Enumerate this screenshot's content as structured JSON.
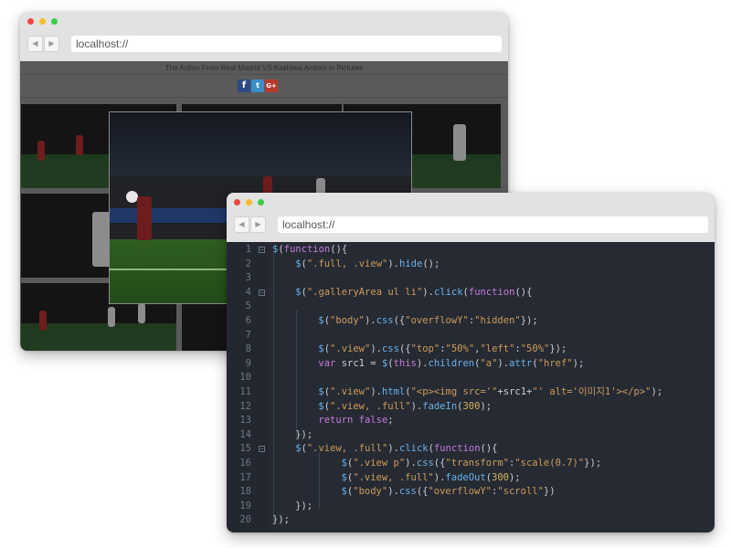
{
  "back_window": {
    "url": "localhost://",
    "caption": "The Action From Real Madrid VS Kashima Antlers in Pictures",
    "share": {
      "facebook": "f",
      "twitter": "t",
      "googleplus": "G+"
    }
  },
  "front_window": {
    "url": "localhost://"
  },
  "code_lines": [
    {
      "n": "1",
      "fold": "−",
      "indent": 0,
      "tokens": [
        [
          "t-fn",
          "$"
        ],
        [
          "t-p",
          "("
        ],
        [
          "t-kw",
          "function"
        ],
        [
          "t-p",
          "(){"
        ]
      ]
    },
    {
      "n": "2",
      "fold": "",
      "indent": 1,
      "tokens": [
        [
          "t-fn",
          "$"
        ],
        [
          "t-p",
          "("
        ],
        [
          "t-str",
          "\".full, .view\""
        ],
        [
          "t-p",
          ")."
        ],
        [
          "t-fn",
          "hide"
        ],
        [
          "t-p",
          "();"
        ]
      ]
    },
    {
      "n": "3",
      "fold": "",
      "indent": 0,
      "tokens": []
    },
    {
      "n": "4",
      "fold": "−",
      "indent": 1,
      "tokens": [
        [
          "t-fn",
          "$"
        ],
        [
          "t-p",
          "("
        ],
        [
          "t-str",
          "\".galleryArea ul li\""
        ],
        [
          "t-p",
          ")."
        ],
        [
          "t-fn",
          "click"
        ],
        [
          "t-p",
          "("
        ],
        [
          "t-kw",
          "function"
        ],
        [
          "t-p",
          "(){"
        ]
      ]
    },
    {
      "n": "5",
      "fold": "",
      "indent": 0,
      "tokens": []
    },
    {
      "n": "6",
      "fold": "",
      "indent": 2,
      "tokens": [
        [
          "t-fn",
          "$"
        ],
        [
          "t-p",
          "("
        ],
        [
          "t-str",
          "\"body\""
        ],
        [
          "t-p",
          ")."
        ],
        [
          "t-fn",
          "css"
        ],
        [
          "t-p",
          "({"
        ],
        [
          "t-str",
          "\"overflowY\""
        ],
        [
          "t-p",
          ":"
        ],
        [
          "t-str",
          "\"hidden\""
        ],
        [
          "t-p",
          "});"
        ]
      ]
    },
    {
      "n": "7",
      "fold": "",
      "indent": 0,
      "tokens": []
    },
    {
      "n": "8",
      "fold": "",
      "indent": 2,
      "tokens": [
        [
          "t-fn",
          "$"
        ],
        [
          "t-p",
          "("
        ],
        [
          "t-str",
          "\".view\""
        ],
        [
          "t-p",
          ")."
        ],
        [
          "t-fn",
          "css"
        ],
        [
          "t-p",
          "({"
        ],
        [
          "t-str",
          "\"top\""
        ],
        [
          "t-p",
          ":"
        ],
        [
          "t-str",
          "\"50%\""
        ],
        [
          "t-p",
          ","
        ],
        [
          "t-str",
          "\"left\""
        ],
        [
          "t-p",
          ":"
        ],
        [
          "t-str",
          "\"50%\""
        ],
        [
          "t-p",
          "});"
        ]
      ]
    },
    {
      "n": "9",
      "fold": "",
      "indent": 2,
      "tokens": [
        [
          "t-kw",
          "var"
        ],
        [
          "t-p",
          " src1 = "
        ],
        [
          "t-fn",
          "$"
        ],
        [
          "t-p",
          "("
        ],
        [
          "t-kw",
          "this"
        ],
        [
          "t-p",
          ")."
        ],
        [
          "t-fn",
          "children"
        ],
        [
          "t-p",
          "("
        ],
        [
          "t-str",
          "\"a\""
        ],
        [
          "t-p",
          ")."
        ],
        [
          "t-fn",
          "attr"
        ],
        [
          "t-p",
          "("
        ],
        [
          "t-str",
          "\"href\""
        ],
        [
          "t-p",
          ");"
        ]
      ]
    },
    {
      "n": "10",
      "fold": "",
      "indent": 0,
      "tokens": []
    },
    {
      "n": "11",
      "fold": "",
      "indent": 2,
      "tokens": [
        [
          "t-fn",
          "$"
        ],
        [
          "t-p",
          "("
        ],
        [
          "t-str",
          "\".view\""
        ],
        [
          "t-p",
          ")."
        ],
        [
          "t-fn",
          "html"
        ],
        [
          "t-p",
          "("
        ],
        [
          "t-str",
          "\"<p><img src='\""
        ],
        [
          "t-p",
          "+src1+"
        ],
        [
          "t-str",
          "\"' alt='이미지1'></p>\""
        ],
        [
          "t-p",
          ");"
        ]
      ]
    },
    {
      "n": "12",
      "fold": "",
      "indent": 2,
      "tokens": [
        [
          "t-fn",
          "$"
        ],
        [
          "t-p",
          "("
        ],
        [
          "t-str",
          "\".view, .full\""
        ],
        [
          "t-p",
          ")."
        ],
        [
          "t-fn",
          "fadeIn"
        ],
        [
          "t-p",
          "("
        ],
        [
          "t-num",
          "300"
        ],
        [
          "t-p",
          ");"
        ]
      ]
    },
    {
      "n": "13",
      "fold": "",
      "indent": 2,
      "tokens": [
        [
          "t-kw",
          "return"
        ],
        [
          "t-p",
          " "
        ],
        [
          "t-kw",
          "false"
        ],
        [
          "t-p",
          ";"
        ]
      ]
    },
    {
      "n": "14",
      "fold": "",
      "indent": 1,
      "tokens": [
        [
          "t-p",
          "});"
        ]
      ]
    },
    {
      "n": "15",
      "fold": "−",
      "indent": 1,
      "tokens": [
        [
          "t-fn",
          "$"
        ],
        [
          "t-p",
          "("
        ],
        [
          "t-str",
          "\".view, .full\""
        ],
        [
          "t-p",
          ")."
        ],
        [
          "t-fn",
          "click"
        ],
        [
          "t-p",
          "("
        ],
        [
          "t-kw",
          "function"
        ],
        [
          "t-p",
          "(){"
        ]
      ]
    },
    {
      "n": "16",
      "fold": "",
      "indent": 3,
      "tokens": [
        [
          "t-fn",
          "$"
        ],
        [
          "t-p",
          "("
        ],
        [
          "t-str",
          "\".view p\""
        ],
        [
          "t-p",
          ")."
        ],
        [
          "t-fn",
          "css"
        ],
        [
          "t-p",
          "({"
        ],
        [
          "t-str",
          "\"transform\""
        ],
        [
          "t-p",
          ":"
        ],
        [
          "t-str",
          "\"scale(0.7)\""
        ],
        [
          "t-p",
          "});"
        ]
      ]
    },
    {
      "n": "17",
      "fold": "",
      "indent": 3,
      "tokens": [
        [
          "t-fn",
          "$"
        ],
        [
          "t-p",
          "("
        ],
        [
          "t-str",
          "\".view, .full\""
        ],
        [
          "t-p",
          ")."
        ],
        [
          "t-fn",
          "fadeOut"
        ],
        [
          "t-p",
          "("
        ],
        [
          "t-num",
          "300"
        ],
        [
          "t-p",
          ");"
        ]
      ]
    },
    {
      "n": "18",
      "fold": "",
      "indent": 3,
      "tokens": [
        [
          "t-fn",
          "$"
        ],
        [
          "t-p",
          "("
        ],
        [
          "t-str",
          "\"body\""
        ],
        [
          "t-p",
          ")."
        ],
        [
          "t-fn",
          "css"
        ],
        [
          "t-p",
          "({"
        ],
        [
          "t-str",
          "\"overflowY\""
        ],
        [
          "t-p",
          ":"
        ],
        [
          "t-str",
          "\"scroll\""
        ],
        [
          "t-p",
          "})"
        ]
      ]
    },
    {
      "n": "19",
      "fold": "",
      "indent": 1,
      "tokens": [
        [
          "t-p",
          "});"
        ]
      ]
    },
    {
      "n": "20",
      "fold": "",
      "indent": 0,
      "tokens": [
        [
          "t-p",
          "});"
        ]
      ]
    }
  ]
}
